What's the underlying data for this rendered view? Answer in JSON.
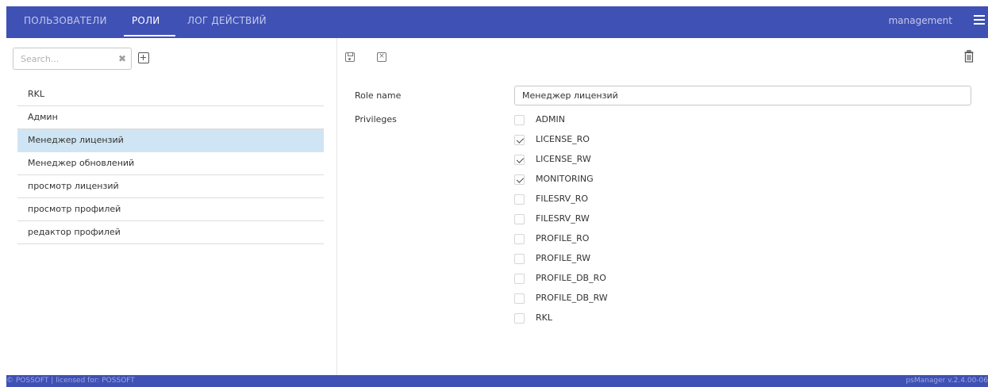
{
  "nav": {
    "tabs": [
      {
        "label": "ПОЛЬЗОВАТЕЛИ"
      },
      {
        "label": "РОЛИ"
      },
      {
        "label": "ЛОГ ДЕЙСТВИЙ"
      }
    ],
    "active_tab": "РОЛИ",
    "user": "management",
    "menu_icon": "hamburger-menu-icon"
  },
  "search": {
    "placeholder": "Search...",
    "value": ""
  },
  "roles": [
    {
      "label": "RKL"
    },
    {
      "label": "Админ"
    },
    {
      "label": "Менеджер лицензий"
    },
    {
      "label": "Менеджер обновлений"
    },
    {
      "label": "просмотр лицензий"
    },
    {
      "label": "просмотр профилей"
    },
    {
      "label": "редактор профилей"
    }
  ],
  "selected_role": "Менеджер лицензий",
  "form": {
    "role_name_label": "Role name",
    "role_name_value": "Менеджер лицензий",
    "privileges_label": "Privileges",
    "privileges": [
      {
        "name": "ADMIN",
        "checked": false
      },
      {
        "name": "LICENSE_RO",
        "checked": true
      },
      {
        "name": "LICENSE_RW",
        "checked": true
      },
      {
        "name": "MONITORING",
        "checked": true
      },
      {
        "name": "FILESRV_RO",
        "checked": false
      },
      {
        "name": "FILESRV_RW",
        "checked": false
      },
      {
        "name": "PROFILE_RO",
        "checked": false
      },
      {
        "name": "PROFILE_RW",
        "checked": false
      },
      {
        "name": "PROFILE_DB_RO",
        "checked": false
      },
      {
        "name": "PROFILE_DB_RW",
        "checked": false
      },
      {
        "name": "RKL",
        "checked": false
      }
    ]
  },
  "footer": {
    "left": "© POSSOFT | licensed for: POSSOFT",
    "right": "psManager v.2.4.00-06"
  },
  "colors": {
    "primary": "#3f51b5",
    "selected_row": "#cfe5f3"
  }
}
